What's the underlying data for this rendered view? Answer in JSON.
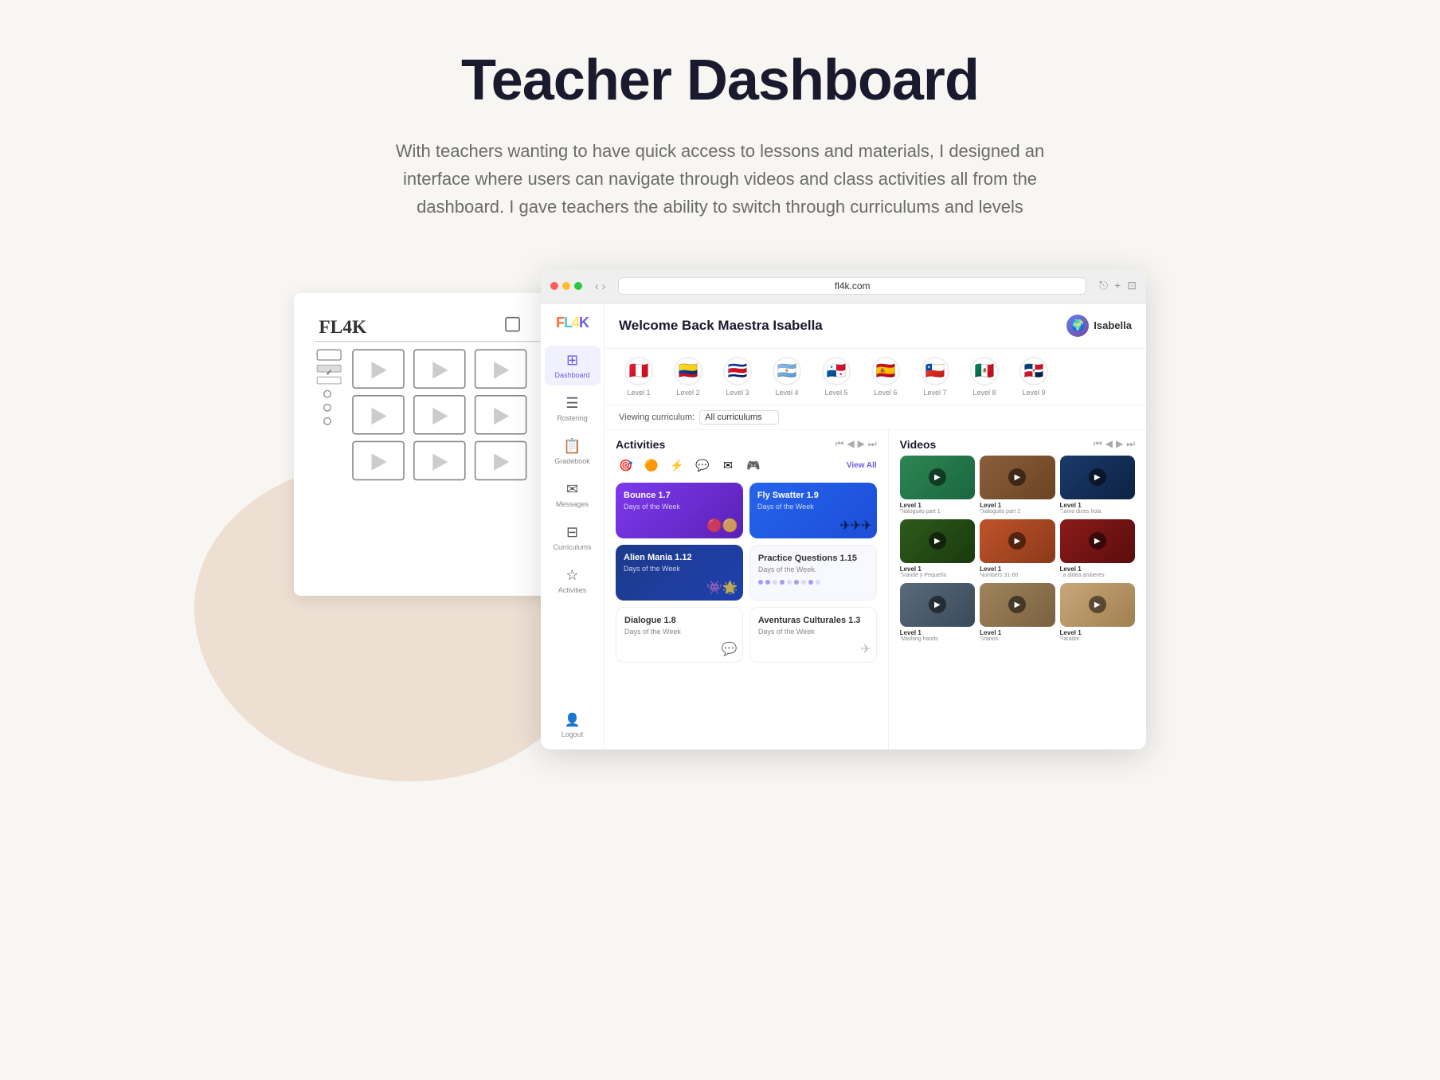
{
  "page": {
    "title": "Teacher Dashboard",
    "subtitle": "With teachers wanting to have quick access to lessons and materials, I designed an interface where users can navigate through videos and class activities all from the dashboard. I gave teachers the ability to switch through curriculums and levels"
  },
  "browser": {
    "url": "fl4k.com",
    "traffic_lights": [
      "red",
      "yellow",
      "green"
    ]
  },
  "app": {
    "logo": "FL4K",
    "welcome_text": "Welcome Back Maestra Isabella",
    "user_name": "Isabella",
    "curriculum_label": "Viewing curriculum:",
    "curriculum_value": "All curriculums"
  },
  "sidebar": {
    "items": [
      {
        "id": "dashboard",
        "label": "Dashboard",
        "icon": "⊞",
        "active": true
      },
      {
        "id": "rostering",
        "label": "Rostering",
        "icon": "☰",
        "active": false
      },
      {
        "id": "gradebook",
        "label": "Gradebook",
        "icon": "📋",
        "active": false
      },
      {
        "id": "messages",
        "label": "Messages",
        "icon": "✉",
        "active": false
      },
      {
        "id": "curriculums",
        "label": "Curriculums",
        "icon": "⊟",
        "active": false
      },
      {
        "id": "activities",
        "label": "Activities",
        "icon": "☆",
        "active": false
      }
    ],
    "logout_label": "Logout"
  },
  "levels": [
    {
      "label": "Level 1",
      "flag": "🇵🇪"
    },
    {
      "label": "Level 2",
      "flag": "🇨🇴"
    },
    {
      "label": "Level 3",
      "flag": "🇨🇷"
    },
    {
      "label": "Level 4",
      "flag": "🇦🇷"
    },
    {
      "label": "Level 5",
      "flag": "🇵🇦"
    },
    {
      "label": "Level 6",
      "flag": "🇪🇸"
    },
    {
      "label": "Level 7",
      "flag": "🇨🇱"
    },
    {
      "label": "Level 8",
      "flag": "🇲🇽"
    },
    {
      "label": "Level 9",
      "flag": "🇩🇴"
    }
  ],
  "activities": {
    "panel_title": "Activities",
    "view_all": "View All",
    "cards": [
      {
        "id": "bounce",
        "title": "Bounce 1.7",
        "subtitle": "Days of the Week",
        "theme": "purple",
        "decoration": "🎮"
      },
      {
        "id": "fly-swatter",
        "title": "Fly Swatter 1.9",
        "subtitle": "Days of the Week",
        "theme": "blue",
        "decoration": "✈️"
      },
      {
        "id": "alien-mania",
        "title": "Alien Mania 1.12",
        "subtitle": "Days of the Week",
        "theme": "dark-blue",
        "decoration": "👾"
      },
      {
        "id": "practice-questions",
        "title": "Practice Questions 1.15",
        "subtitle": "Days of the Week.",
        "theme": "light-dots",
        "decoration": "⭐"
      },
      {
        "id": "dialogue",
        "title": "Dialogue 1.8",
        "subtitle": "Days of the Week",
        "theme": "white-card",
        "decoration": "💬"
      },
      {
        "id": "aventuras",
        "title": "Aventuras Culturales 1.3",
        "subtitle": "Days of the Week",
        "theme": "white-card",
        "decoration": "✈️"
      }
    ]
  },
  "videos": {
    "panel_title": "Videos",
    "items": [
      {
        "label": "Level 1",
        "sublabel": "Dialoguito part 1",
        "color": "vt-green"
      },
      {
        "label": "Level 1",
        "sublabel": "Dialoguito part 2",
        "color": "vt-brown"
      },
      {
        "label": "Level 1",
        "sublabel": "Como dices hola",
        "color": "vt-blue-dark"
      },
      {
        "label": "Level 1",
        "sublabel": "Grande y Pequeño",
        "color": "vt-forest"
      },
      {
        "label": "Level 1",
        "sublabel": "Numbers 31-60",
        "color": "vt-orange"
      },
      {
        "label": "Level 1",
        "sublabel": "La aldea amberes",
        "color": "vt-red"
      },
      {
        "label": "Level 1",
        "sublabel": "Washing hands",
        "color": "vt-gray"
      },
      {
        "label": "Level 1",
        "sublabel": "Granos",
        "color": "vt-tan"
      },
      {
        "label": "Level 1",
        "sublabel": "Parador",
        "color": "vt-beige"
      }
    ]
  }
}
